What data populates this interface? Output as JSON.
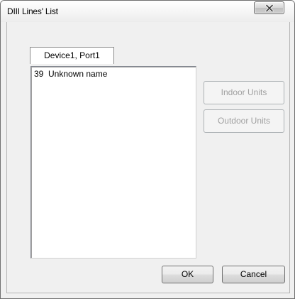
{
  "window": {
    "title": "DIII Lines' List",
    "close_icon": "close-x-icon"
  },
  "tab": {
    "label": "Device1, Port1"
  },
  "list": {
    "items": [
      {
        "label": "39  Unknown name"
      }
    ]
  },
  "buttons": {
    "indoor_units": {
      "label": "Indoor Units",
      "enabled": false
    },
    "outdoor_units": {
      "label": "Outdoor Units",
      "enabled": false
    },
    "ok": {
      "label": "OK"
    },
    "cancel": {
      "label": "Cancel"
    }
  }
}
